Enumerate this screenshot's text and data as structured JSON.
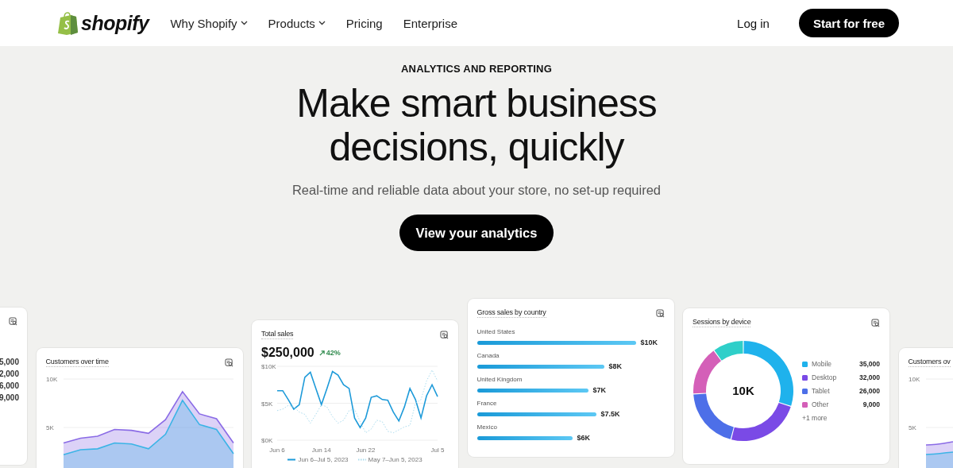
{
  "header": {
    "logo": "shopify",
    "nav": [
      {
        "label": "Why Shopify",
        "dropdown": true
      },
      {
        "label": "Products",
        "dropdown": true
      },
      {
        "label": "Pricing",
        "dropdown": false
      },
      {
        "label": "Enterprise",
        "dropdown": false
      }
    ],
    "login": "Log in",
    "cta": "Start for free"
  },
  "hero": {
    "eyebrow": "ANALYTICS AND REPORTING",
    "title": "Make smart business decisions, quickly",
    "subtitle": "Real-time and reliable data about your store, no set-up required",
    "button": "View your analytics"
  },
  "cards": [
    {
      "legend_values": [
        "5,000",
        "2,000",
        "6,000",
        "9,000"
      ]
    },
    {
      "title": "Customers over time",
      "chart_data": {
        "type": "area",
        "stacked": true,
        "categories": [
          null,
          null,
          null,
          null,
          null,
          null,
          null,
          null,
          null,
          null,
          null
        ],
        "ylim": [
          0,
          10000
        ],
        "yticks": [
          {
            "value": 5000,
            "label": "5K"
          },
          {
            "value": 10000,
            "label": "10K"
          }
        ],
        "series": [
          {
            "color": "#3bb4e6",
            "values": [
              2200,
              2700,
              2800,
              3400,
              3300,
              2800,
              4300,
              7800,
              5300,
              4800,
              2300
            ]
          },
          {
            "color": "#8a6be6",
            "values": [
              1200,
              1200,
              1300,
              1400,
              1400,
              1600,
              1500,
              900,
              1100,
              1100,
              1100
            ]
          }
        ]
      }
    },
    {
      "title": "Total sales",
      "total": "$250,000",
      "change": "42%",
      "chart_data": {
        "type": "line",
        "ylim": [
          0,
          10000
        ],
        "yticks": [
          {
            "value": 0,
            "label": "$0K"
          },
          {
            "value": 5000,
            "label": "$5K"
          },
          {
            "value": 10000,
            "label": "$10K"
          }
        ],
        "categories": [
          "Jun 6",
          null,
          null,
          null,
          null,
          null,
          null,
          null,
          "Jun 14",
          null,
          null,
          null,
          null,
          null,
          null,
          null,
          "Jun 22",
          null,
          null,
          null,
          null,
          null,
          null,
          null,
          null,
          null,
          null,
          null,
          null,
          "Jul 5"
        ],
        "series": [
          {
            "name": "Jun 6–Jul 5, 2023",
            "color": "#1d9ad9",
            "line_style": "solid",
            "values": [
              6700,
              6700,
              5500,
              4200,
              4800,
              8500,
              9200,
              7000,
              4800,
              7000,
              9300,
              8800,
              7500,
              7000,
              3000,
              1700,
              3000,
              5800,
              6000,
              5500,
              5400,
              3800,
              2600,
              4500,
              7000,
              5500,
              3000,
              6000,
              7500,
              5900
            ]
          },
          {
            "name": "May 7–Jun 5, 2023",
            "color": "#a9dbee",
            "line_style": "dashed",
            "values": [
              4000,
              4200,
              4700,
              4500,
              3800,
              3500,
              2300,
              3500,
              4800,
              4500,
              3200,
              2300,
              2700,
              4000,
              4200,
              2500,
              1000,
              1500,
              2700,
              2500,
              1200,
              1000,
              1400,
              1800,
              2000,
              5000,
              5500,
              8000,
              9500,
              8000
            ]
          }
        ]
      }
    },
    {
      "title": "Gross sales by country",
      "chart_data": {
        "type": "bar",
        "orientation": "horizontal",
        "xlim": [
          0,
          10000
        ],
        "categories": [
          "United States",
          "Canada",
          "United Kingdom",
          "France",
          "Mexico"
        ],
        "values": [
          10000,
          8000,
          7000,
          7500,
          6000
        ],
        "value_labels": [
          "$10K",
          "$8K",
          "$7K",
          "$7.5K",
          "$6K"
        ]
      }
    },
    {
      "title": "Sessions by device",
      "center_label": "10K",
      "legend": [
        {
          "label": "Mobile",
          "value": "35,000",
          "color": "#1fb2ec"
        },
        {
          "label": "Desktop",
          "value": "32,000",
          "color": "#7a4ae6"
        },
        {
          "label": "Tablet",
          "value": "26,000",
          "color": "#4d6fe8"
        },
        {
          "label": "Other",
          "value": "9,000",
          "color": "#d45fb8"
        }
      ],
      "more": "+1 more"
    },
    {
      "title": "Customers ov",
      "tick_labels": [
        "10K",
        "5K"
      ]
    }
  ]
}
